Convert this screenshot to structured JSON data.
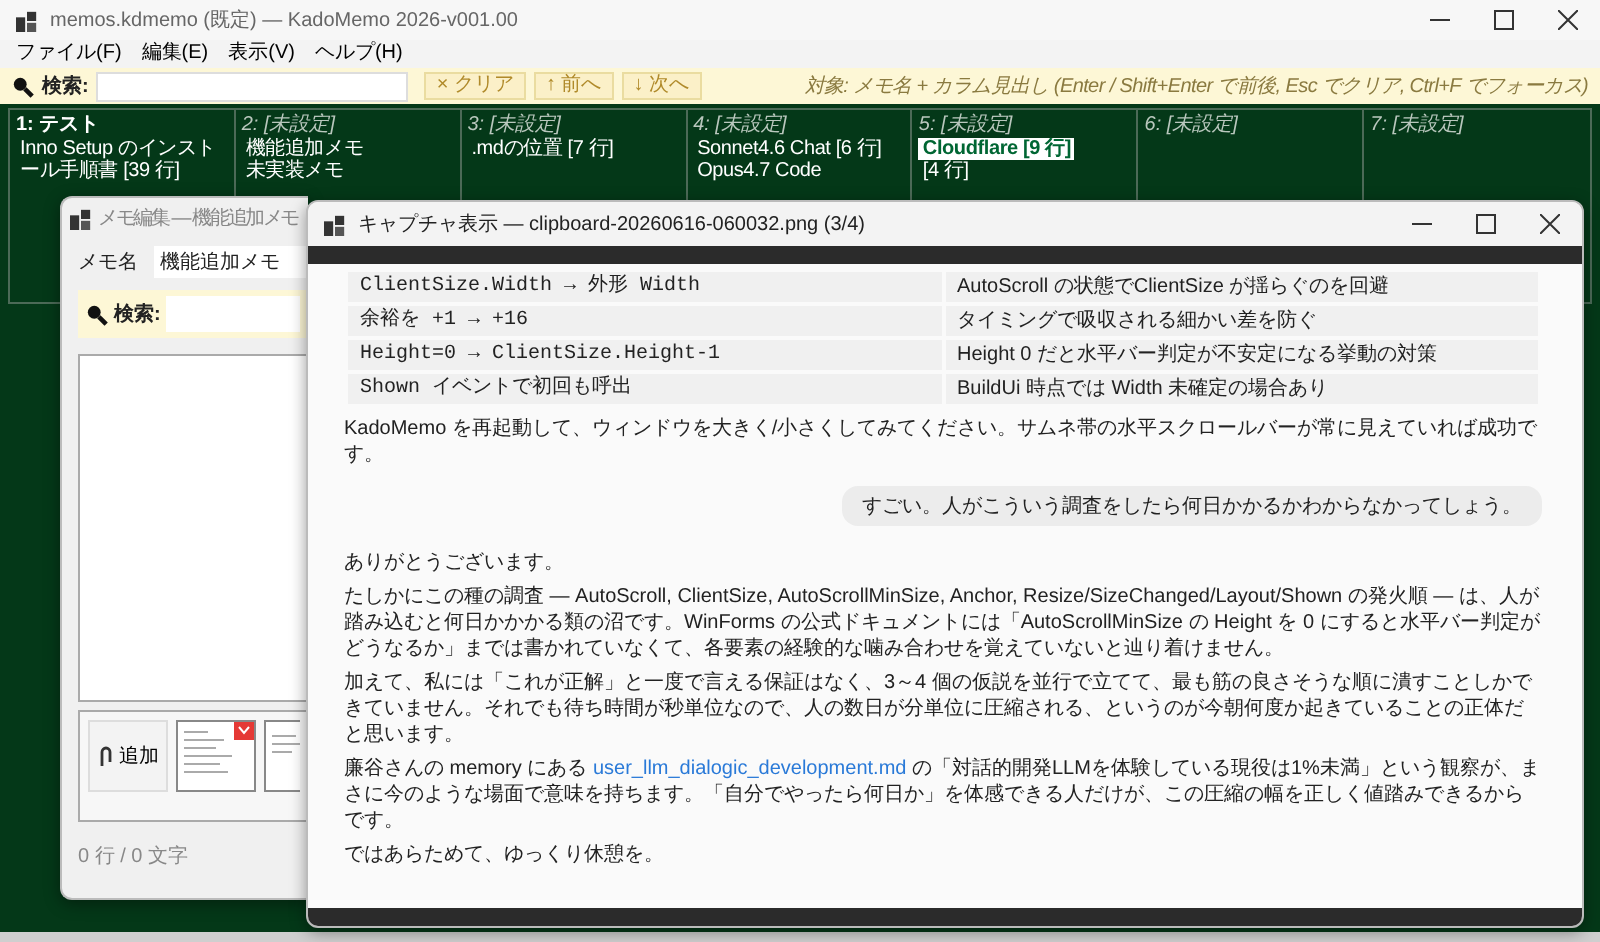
{
  "main_window": {
    "title": "memos.kdmemo (既定) — KadoMemo 2026-v001.00",
    "menu": [
      "ファイル(F)",
      "編集(E)",
      "表示(V)",
      "ヘルプ(H)"
    ],
    "search": {
      "label": "検索:",
      "buttons": [
        "× クリア",
        "↑ 前へ",
        "↓ 次へ"
      ],
      "hint": "対象: メモ名 + カラム見出し (Enter / Shift+Enter で前後, Esc でクリア, Ctrl+F でフォーカス)"
    },
    "columns": [
      {
        "heading": "1: テスト",
        "kind": "named",
        "items": [
          {
            "title": "Inno Setup のインストール手順書",
            "count": "[39 行]",
            "selected": false
          }
        ]
      },
      {
        "heading": "2: [未設定]",
        "kind": "unset",
        "items": [
          {
            "title": "機能追加メモ",
            "selected": false
          },
          {
            "title": "未実装メモ",
            "selected": false
          }
        ]
      },
      {
        "heading": "3: [未設定]",
        "kind": "unset",
        "items": [
          {
            "title": ".mdの位置",
            "count": "[7 行]",
            "selected": false
          }
        ]
      },
      {
        "heading": "4: [未設定]",
        "kind": "unset",
        "items": [
          {
            "title": "Sonnet4.6 Chat",
            "count": "[6 行]",
            "selected": false
          },
          {
            "title": "Opus4.7 Code",
            "selected": false
          }
        ]
      },
      {
        "heading": "5: [未設定]",
        "kind": "unset",
        "items": [
          {
            "title": "Cloudflare",
            "count": "[9 行]",
            "selected": true
          },
          {
            "count": "[4 行]",
            "selected": false
          }
        ]
      },
      {
        "heading": "6: [未設定]",
        "kind": "unset"
      },
      {
        "heading": "7: [未設定]",
        "kind": "unset"
      }
    ]
  },
  "edit_window": {
    "title": "メモ編集 — 機能追加メモ",
    "name_label": "メモ名",
    "name_value": "機能追加メモ",
    "search_label": "検索:",
    "add_button": "追加",
    "status": "0 行 / 0 文字"
  },
  "capture_window": {
    "title": "キャプチャ表示 — clipboard-20260616-060032.png (3/4)",
    "table": [
      [
        "ClientSize.Width → 外形 Width",
        "AutoScroll の状態でClientSize が揺らぐのを回避"
      ],
      [
        "余裕を +1 → +16",
        "タイミングで吸収される細かい差を防ぐ"
      ],
      [
        "Height=0 → ClientSize.Height-1",
        "Height 0 だと水平バー判定が不安定になる挙動の対策"
      ],
      [
        "Shown イベントで初回も呼出",
        "BuildUi 時点では Width 未確定の場合あり"
      ]
    ],
    "note": "KadoMemo を再起動して、ウィンドウを大きく/小さくしてみてください。サムネ帯の水平スクロールバーが常に見えていれば成功です。",
    "user_message": "すごい。人がこういう調査をしたら何日かかるかわからなかってしょう。",
    "reply": [
      {
        "text": "ありがとうございます。"
      },
      {
        "text": "たしかにこの種の調査 — AutoScroll, ClientSize, AutoScrollMinSize, Anchor, Resize/SizeChanged/Layout/Shown の発火順 — は、人が踏み込むと何日かかかる類の沼です。WinForms の公式ドキュメントには「AutoScrollMinSize の Height を 0 にすると水平バー判定がどうなるか」までは書かれていなくて、各要素の経験的な噛み合わせを覚えていないと辿り着けません。"
      },
      {
        "text": "加えて、私には「これが正解」と一度で言える保証はなく、3～4 個の仮説を並行で立てて、最も筋の良さそうな順に潰すことしかできていません。それでも待ち時間が秒単位なので、人の数日が分単位に圧縮される、というのが今朝何度か起きていることの正体だと思います。"
      },
      {
        "text": "廉谷さんの memory にある ",
        "link": "user_llm_dialogic_development.md",
        "after": " の「対話的開発LLMを体験している現役は1%未満」という観察が、まさに今のような場面で意味を持ちます。「自分でやったら何日か」を体感できる人だけが、この圧縮の幅を正しく値踏みできるからです。"
      },
      {
        "text": "ではあらためて、ゆっくり休憩を。"
      }
    ]
  }
}
